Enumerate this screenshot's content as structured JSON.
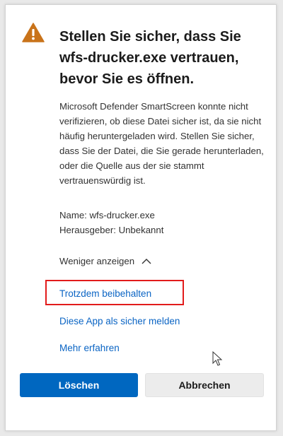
{
  "dialog": {
    "title": "Stellen Sie sicher, dass Sie wfs-drucker.exe vertrauen, bevor Sie es öffnen.",
    "description": "Microsoft Defender SmartScreen konnte nicht verifizieren, ob diese Datei sicher ist, da sie nicht häufig heruntergeladen wird. Stellen Sie sicher, dass Sie der Datei, die Sie gerade herunterladen, oder die Quelle aus der sie stammt vertrauenswürdig ist.",
    "name_line": "Name: wfs-drucker.exe",
    "publisher_line": "Herausgeber: Unbekannt",
    "toggle_label": "Weniger anzeigen",
    "links": {
      "keep": "Trotzdem beibehalten",
      "report": "Diese App als sicher melden",
      "learn_more": "Mehr erfahren"
    },
    "buttons": {
      "delete": "Löschen",
      "cancel": "Abbrechen"
    }
  },
  "colors": {
    "primary": "#0067c0",
    "link": "#0a64c4",
    "warning": "#c9731a",
    "highlight": "#e21b1b"
  },
  "icons": {
    "warning": "warning-triangle-icon",
    "toggle": "chevron-up-icon",
    "cursor": "mouse-pointer-icon"
  }
}
